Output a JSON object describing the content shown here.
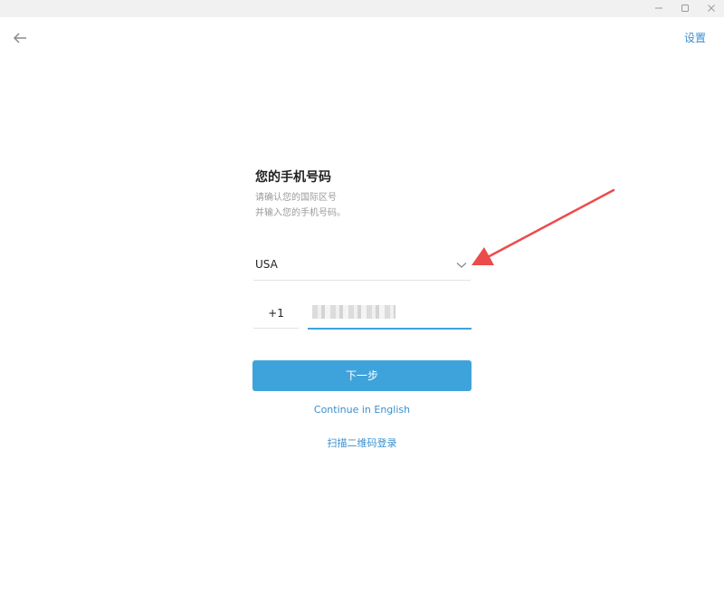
{
  "window": {
    "controls": [
      "minimize",
      "maximize",
      "close"
    ]
  },
  "header": {
    "settings_label": "设置"
  },
  "login": {
    "title": "您的手机号码",
    "subtitle_lines": [
      "请确认您的国际区号",
      "并输入您的手机号码。"
    ],
    "country": {
      "value": "USA"
    },
    "phone": {
      "country_code": "+1",
      "number_obscured": true
    },
    "next_label": "下一步",
    "continue_english_label": "Continue in English",
    "qr_login_label": "扫描二维码登录"
  },
  "colors": {
    "accent": "#3fa3db",
    "link": "#3a8fcc",
    "annotation_arrow": "#ec4b4b"
  },
  "icons": {
    "back": "arrow-left-icon",
    "chevron": "chevron-down-icon"
  }
}
